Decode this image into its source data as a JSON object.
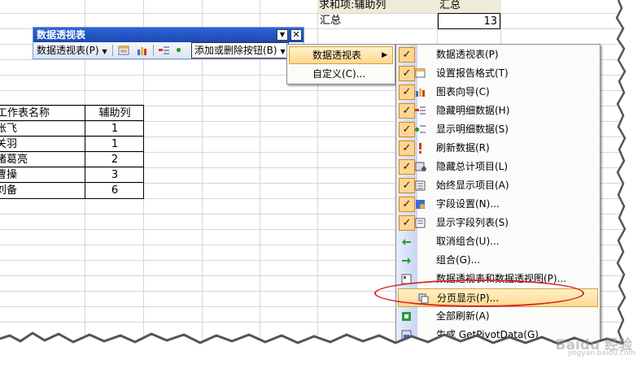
{
  "pivot_cells": {
    "header_label": "求和项:辅助列",
    "header_value": "汇总",
    "total_label": "汇总",
    "total_value": "13"
  },
  "source_table": {
    "headers": [
      "工作表名称",
      "辅助列"
    ],
    "rows": [
      {
        "name": "张飞",
        "value": "1"
      },
      {
        "name": "关羽",
        "value": "1"
      },
      {
        "name": "诸葛亮",
        "value": "2"
      },
      {
        "name": "曹操",
        "value": "3"
      },
      {
        "name": "刘备",
        "value": "6"
      }
    ]
  },
  "toolbar": {
    "title": "数据透视表",
    "menu_label": "数据透视表(P)",
    "add_remove_label": "添加或删除按钮(B)"
  },
  "submenu1": {
    "items": [
      {
        "label": "数据透视表",
        "has_arrow": true
      },
      {
        "label": "自定义(C)..."
      }
    ]
  },
  "menu": {
    "items": [
      {
        "label": "数据透视表(P)",
        "checked": true,
        "icon": "pivot-table-icon"
      },
      {
        "label": "设置报告格式(T)",
        "checked": true,
        "icon": "format-report-icon"
      },
      {
        "label": "图表向导(C)",
        "checked": true,
        "icon": "chart-wizard-icon"
      },
      {
        "label": "隐藏明细数据(H)",
        "checked": true,
        "icon": "hide-detail-icon"
      },
      {
        "label": "显示明细数据(S)",
        "checked": true,
        "icon": "show-detail-icon"
      },
      {
        "label": "刷新数据(R)",
        "checked": true,
        "icon": "refresh-icon"
      },
      {
        "label": "隐藏总计项目(L)",
        "checked": true,
        "icon": "hide-totals-icon"
      },
      {
        "label": "始终显示项目(A)",
        "checked": true,
        "icon": "always-display-icon"
      },
      {
        "label": "字段设置(N)...",
        "checked": true,
        "icon": "field-settings-icon"
      },
      {
        "label": "显示字段列表(S)",
        "checked": true,
        "icon": "field-list-icon"
      },
      {
        "label": "取消组合(U)...",
        "checked": false,
        "icon": "ungroup-icon"
      },
      {
        "label": "组合(G)...",
        "checked": false,
        "icon": "group-icon"
      },
      {
        "label": "数据透视表和数据透视图(P)...",
        "checked": false,
        "icon": "pivot-chart-wizard-icon"
      },
      {
        "label": "分页显示(P)...",
        "checked": false,
        "icon": "show-pages-icon",
        "highlighted": true
      },
      {
        "label": "全部刷新(A)",
        "checked": false,
        "icon": "refresh-all-icon"
      },
      {
        "label": "生成 GetPivotData(G)",
        "checked": false,
        "icon": "getpivotdata-icon"
      }
    ]
  },
  "watermark": {
    "text": "Baidu 经验",
    "sub": "jingyan.baidu.com"
  },
  "colors": {
    "title_bar": "#1c47b0",
    "check_bg": "#ffd590",
    "highlight": "#ffd98e",
    "annotation_oval": "#d6262b"
  }
}
